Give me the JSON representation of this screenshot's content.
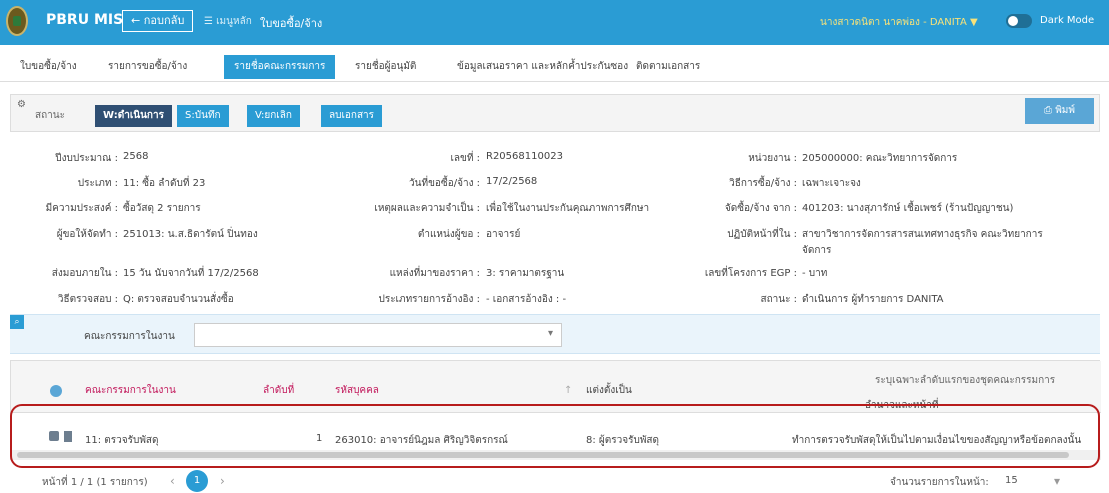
{
  "header": {
    "title": "PBRU MIS",
    "back_label": "← กอบกลับ",
    "menu_label": "☰ เมนูหลัก",
    "crumb": "ใบขอซื้อ/จ้าง",
    "user": "นางสาวดนิตา นาคพ่อง - DANITA ▼",
    "dark_mode": "Dark Mode"
  },
  "tabs": [
    {
      "label": "ใบขอซื้อ/จ้าง"
    },
    {
      "label": "รายการขอซื้อ/จ้าง"
    },
    {
      "label": "รายชื่อคณะกรรมการ"
    },
    {
      "label": "รายชื่อผู้อนุมัติ"
    },
    {
      "label": "ข้อมูลเสนอราคา และหลักค้ำประกันซอง"
    },
    {
      "label": "ติดตามเอกสาร"
    }
  ],
  "status": {
    "label": "สถานะ",
    "buttons": [
      {
        "label": "W:ดำเนินการ"
      },
      {
        "label": "S:บันทึก"
      },
      {
        "label": "V:ยกเลิก"
      },
      {
        "label": "ลบเอกสาร"
      }
    ],
    "print": "⎙ พิมพ์"
  },
  "info": {
    "budget_label": "ปีงบประมาณ :",
    "budget_value": "2568",
    "type_label": "ประเภท :",
    "type_value": "11: ซื้อ ลำดับที่ 23",
    "purpose_label": "มีความประสงค์ :",
    "purpose_value": "ซื้อวัสดุ 2 รายการ",
    "requester_label": "ผู้ขอให้จัดทำ :",
    "requester_value": "251013: น.ส.ธิดารัตน์ ปิ่นทอง",
    "delivery_label": "ส่งมอบภายใน :",
    "delivery_value": "15 วัน นับจากวันที่ 17/2/2568",
    "inspection_label": "วิธีตรวจสอบ :",
    "inspection_value": "Q: ตรวจสอบจำนวนสั่งซื้อ",
    "doc_no_label": "เลขที่ :",
    "doc_no_value": "R20568110023",
    "date_label": "วันที่ขอซื้อ/จ้าง :",
    "date_value": "17/2/2568",
    "reason_label": "เหตุผลและความจำเป็น :",
    "reason_value": "เพื่อใช้ในงานประกันคุณภาพการศึกษา",
    "position_label": "ตำแหน่งผู้ขอ :",
    "position_value": "อาจารย์",
    "source_label": "แหล่งที่มาของราคา :",
    "source_value": "3: ราคามาตรฐาน",
    "ref_label": "ประเภทรายการอ้างอิง :",
    "ref_value": "- เอกสารอ้างอิง : -",
    "unit_label": "หน่วยงาน :",
    "unit_value": "205000000: คณะวิทยาการจัดการ",
    "method_label": "วิธีการซื้อ/จ้าง :",
    "method_value": "เฉพาะเจาะจง",
    "vendor_label": "จัดซื้อ/จ้าง จาก :",
    "vendor_value": "401203: นางสุภารักษ์ เชื้อเพชร์ (ร้านปัญญาชน)",
    "duty_label": "ปฏิบัติหน้าที่ใน :",
    "duty_value": "สาขาวิชาการจัดการสารสนเทศทางธุรกิจ คณะวิทยาการ",
    "duty_value2": "จัดการ",
    "egp_label": "เลขที่โครงการ EGP :",
    "egp_value": "- บาท",
    "state_label": "สถานะ :",
    "state_value": "ดำเนินการ ผู้ทำรายการ DANITA"
  },
  "filter": {
    "label": "คณะกรรมการในงาน"
  },
  "grid": {
    "headers": [
      "คณะกรรมการในงาน",
      "ลำดับที่",
      "รหัสบุคคล",
      "แต่งตั้งเป็น",
      "ระบุเฉพาะลำดับแรกของชุดคณะกรรมการ",
      "อำนาจและหน้าที่"
    ],
    "row": {
      "committee": "11: ตรวจรับพัสดุ",
      "order": "1",
      "person": "263010: อาจารย์นิฎมล ศิริญวิจิตรกรณ์",
      "role": "8: ผู้ตรวจรับพัสดุ",
      "duty": "ทำการตรวจรับพัสดุให้เป็นไปตามเงื่อนไขของสัญญาหรือข้อตกลงนั้น"
    }
  },
  "pager": {
    "info": "หน้าที่ 1 / 1 (1 รายการ)",
    "page": "1",
    "per_page_label": "จำนวนรายการในหน้า:",
    "per_page": "15"
  }
}
